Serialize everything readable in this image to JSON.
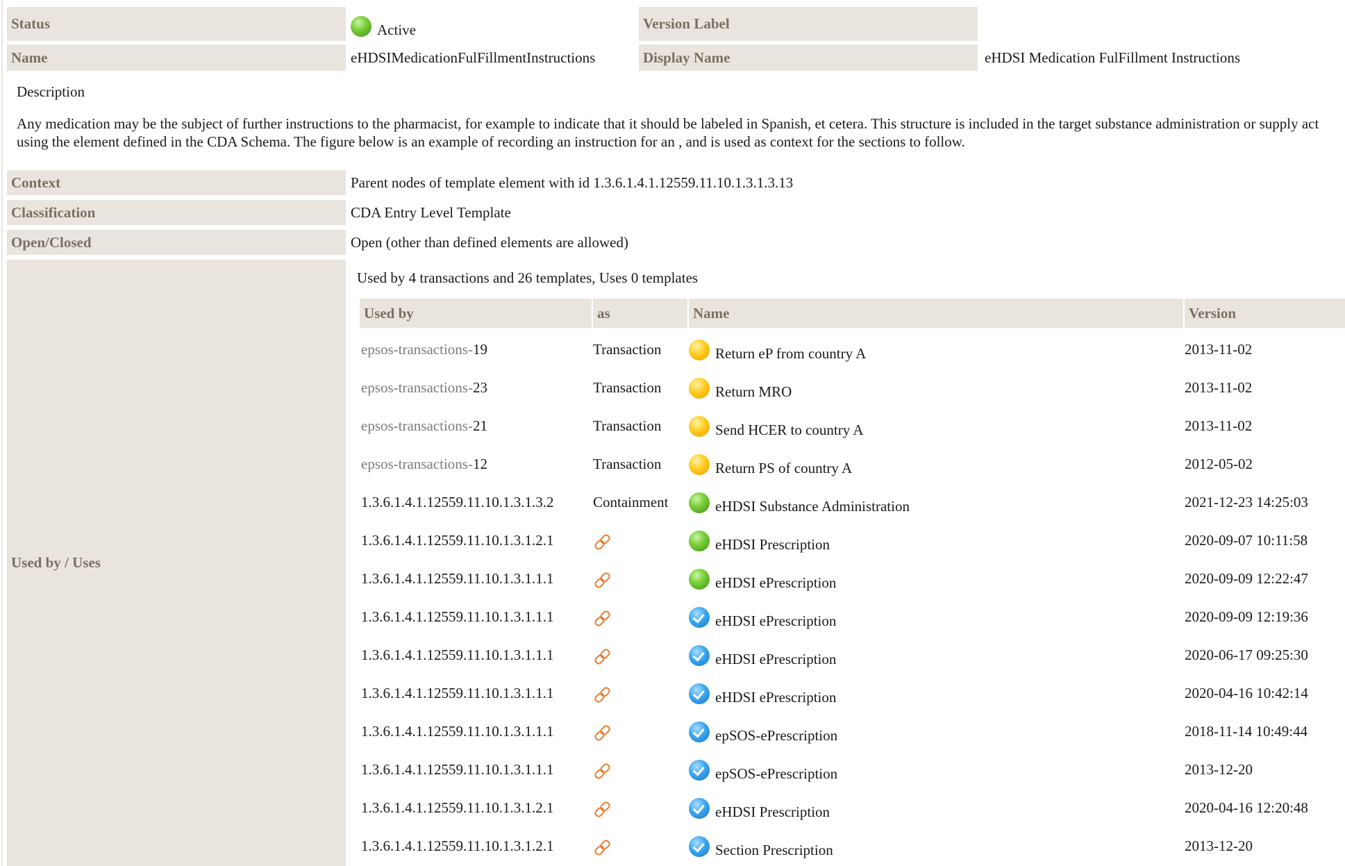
{
  "status": {
    "label": "Status",
    "value": "Active",
    "icon": "green-status-icon"
  },
  "version_label": {
    "label": "Version Label",
    "value": ""
  },
  "name": {
    "label": "Name",
    "value": "eHDSIMedicationFulFillmentInstructions"
  },
  "display_name": {
    "label": "Display Name",
    "value": "eHDSI Medication FulFillment Instructions"
  },
  "description": {
    "title": "Description",
    "text": "Any medication may be the subject of further instructions to the pharmacist, for example to indicate that it should be labeled in Spanish, et cetera. This structure is included in the target substance administration or supply act using the element defined in the CDA Schema. The figure below is an example of recording an instruction for an , and is used as context for the sections to follow."
  },
  "context": {
    "label": "Context",
    "value": "Parent nodes of template element with id 1.3.6.1.4.1.12559.11.10.1.3.1.3.13"
  },
  "classification": {
    "label": "Classification",
    "value": "CDA Entry Level Template"
  },
  "open_closed": {
    "label": "Open/Closed",
    "value": "Open (other than defined elements are allowed)"
  },
  "usage": {
    "label": "Used by / Uses",
    "summary": "Used by 4 transactions and 26 templates, Uses 0 templates",
    "columns": {
      "used_by": "Used by",
      "as": "as",
      "name": "Name",
      "version": "Version"
    },
    "rows": [
      {
        "prefix": "epsos-transactions-",
        "suffix": "19",
        "as": "Transaction",
        "status": "yellow",
        "name": "Return eP from country A",
        "version": "2013-11-02"
      },
      {
        "prefix": "epsos-transactions-",
        "suffix": "23",
        "as": "Transaction",
        "status": "yellow",
        "name": "Return MRO",
        "version": "2013-11-02"
      },
      {
        "prefix": "epsos-transactions-",
        "suffix": "21",
        "as": "Transaction",
        "status": "yellow",
        "name": "Send HCER to country A",
        "version": "2013-11-02"
      },
      {
        "prefix": "epsos-transactions-",
        "suffix": "12",
        "as": "Transaction",
        "status": "yellow",
        "name": "Return PS of country A",
        "version": "2012-05-02"
      },
      {
        "prefix": "",
        "suffix": "1.3.6.1.4.1.12559.11.10.1.3.1.3.2",
        "as": "Containment",
        "status": "green",
        "name": "eHDSI Substance Administration",
        "version": "2021-12-23 14:25:03"
      },
      {
        "prefix": "",
        "suffix": "1.3.6.1.4.1.12559.11.10.1.3.1.2.1",
        "as_icon": "link-icon",
        "status": "green",
        "name": "eHDSI Prescription",
        "version": "2020-09-07 10:11:58"
      },
      {
        "prefix": "",
        "suffix": "1.3.6.1.4.1.12559.11.10.1.3.1.1.1",
        "as_icon": "link-icon",
        "status": "green",
        "name": "eHDSI ePrescription",
        "version": "2020-09-09 12:22:47"
      },
      {
        "prefix": "",
        "suffix": "1.3.6.1.4.1.12559.11.10.1.3.1.1.1",
        "as_icon": "link-icon",
        "status": "blue",
        "name": "eHDSI ePrescription",
        "version": "2020-09-09 12:19:36"
      },
      {
        "prefix": "",
        "suffix": "1.3.6.1.4.1.12559.11.10.1.3.1.1.1",
        "as_icon": "link-icon",
        "status": "blue",
        "name": "eHDSI ePrescription",
        "version": "2020-06-17 09:25:30"
      },
      {
        "prefix": "",
        "suffix": "1.3.6.1.4.1.12559.11.10.1.3.1.1.1",
        "as_icon": "link-icon",
        "status": "blue",
        "name": "eHDSI ePrescription",
        "version": "2020-04-16 10:42:14"
      },
      {
        "prefix": "",
        "suffix": "1.3.6.1.4.1.12559.11.10.1.3.1.1.1",
        "as_icon": "link-icon",
        "status": "blue",
        "name": "epSOS-ePrescription",
        "version": "2018-11-14 10:49:44"
      },
      {
        "prefix": "",
        "suffix": "1.3.6.1.4.1.12559.11.10.1.3.1.1.1",
        "as_icon": "link-icon",
        "status": "blue",
        "name": "epSOS-ePrescription",
        "version": "2013-12-20"
      },
      {
        "prefix": "",
        "suffix": "1.3.6.1.4.1.12559.11.10.1.3.1.2.1",
        "as_icon": "link-icon",
        "status": "blue",
        "name": "eHDSI Prescription",
        "version": "2020-04-16 12:20:48"
      },
      {
        "prefix": "",
        "suffix": "1.3.6.1.4.1.12559.11.10.1.3.1.2.1",
        "as_icon": "link-icon",
        "status": "blue",
        "name": "Section Prescription",
        "version": "2013-12-20"
      }
    ]
  }
}
